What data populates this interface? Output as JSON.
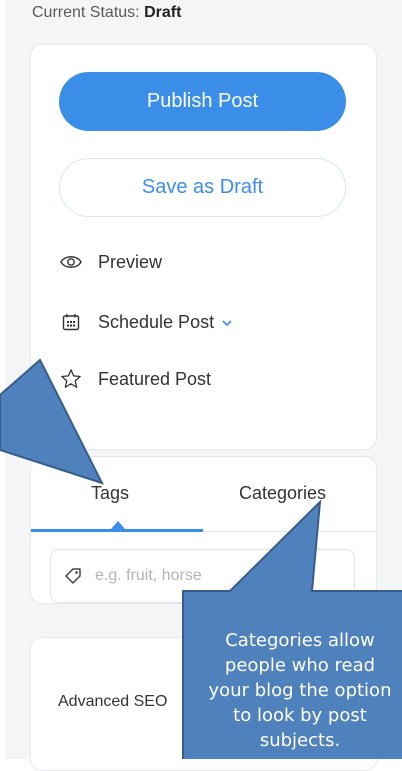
{
  "status": {
    "label": "Current Status:",
    "value": "Draft"
  },
  "actions": {
    "publish_label": "Publish Post",
    "draft_label": "Save as Draft",
    "preview_label": "Preview",
    "schedule_label": "Schedule Post",
    "featured_label": "Featured Post"
  },
  "tabs": {
    "tags_label": "Tags",
    "categories_label": "Categories"
  },
  "tag_input": {
    "placeholder": "e.g. fruit, horse"
  },
  "seo": {
    "label": "Advanced SEO"
  },
  "callout": {
    "lines": [
      "Categories allow",
      "people who read",
      "your blog the option",
      "to look by post",
      "subjects."
    ]
  },
  "colors": {
    "accent": "#3b8ee8",
    "callout_fill": "#4f81bd",
    "callout_border": "#385d8a"
  },
  "icons": {
    "preview": "eye-icon",
    "schedule": "calendar-icon",
    "featured": "star-icon",
    "tag": "tag-icon",
    "chevron": "chevron-down-icon"
  }
}
